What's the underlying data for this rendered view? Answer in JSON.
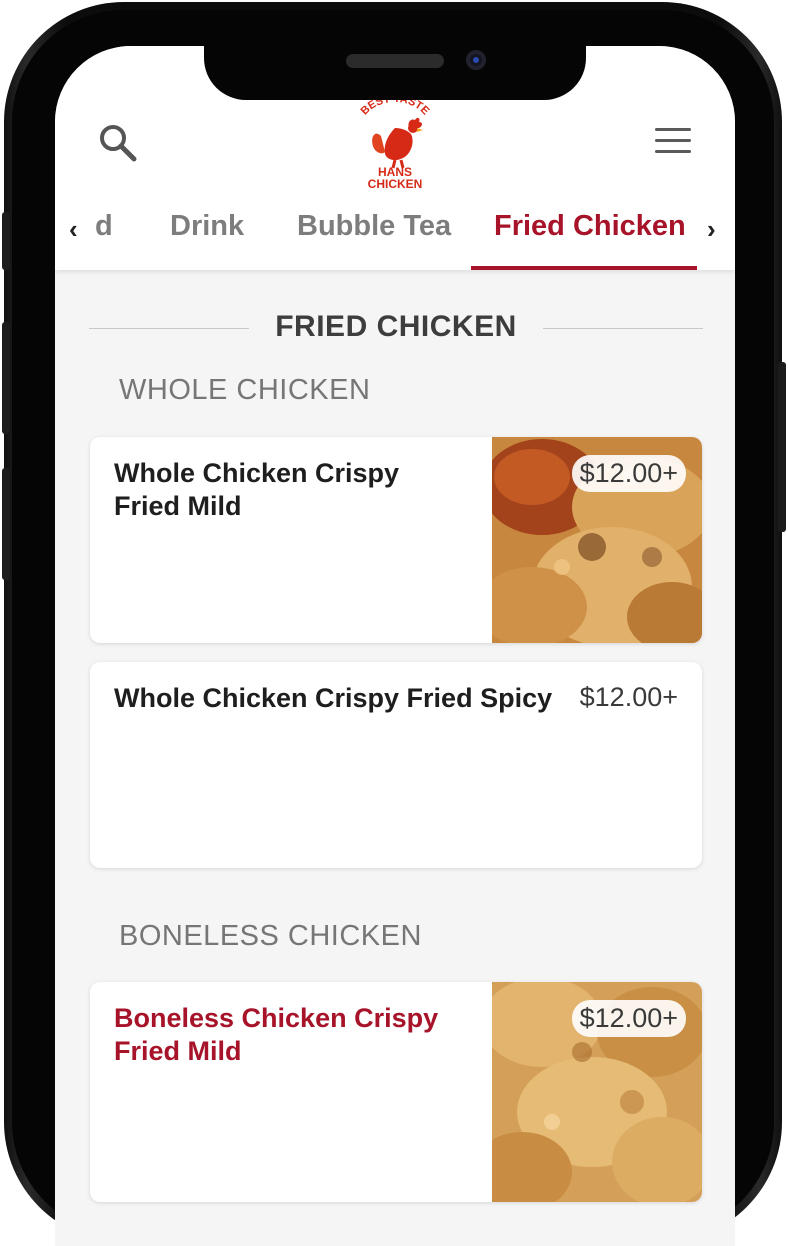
{
  "header": {
    "logo_text": [
      "BEST TASTE",
      "HANS",
      "CHICKEN"
    ]
  },
  "tabs": {
    "left_arrow": "‹",
    "right_arrow": "›",
    "items": [
      {
        "label": "d"
      },
      {
        "label": "Drink"
      },
      {
        "label": "Bubble Tea"
      },
      {
        "label": "Fried Chicken",
        "active": true
      }
    ]
  },
  "section": {
    "title": "FRIED CHICKEN",
    "categories": [
      {
        "title": "WHOLE CHICKEN",
        "items": [
          {
            "name_line1": "Whole Chicken Crispy",
            "name_line2": "Fried Mild",
            "price": "$12.00+",
            "has_image": true
          },
          {
            "name_line1": "Whole Chicken Crispy Fried Spicy",
            "price": "$12.00+",
            "has_image": false
          }
        ]
      },
      {
        "title": "BONELESS CHICKEN",
        "items": [
          {
            "name_line1": "Boneless Chicken Crispy",
            "name_line2": "Fried Mild",
            "price": "$12.00+",
            "has_image": true
          }
        ]
      }
    ]
  },
  "colors": {
    "accent": "#a7142a",
    "tab_inactive": "#7d7d7d",
    "background": "#f5f5f5"
  },
  "icons": [
    "search-icon",
    "hamburger-menu-icon",
    "chevron-left-icon",
    "chevron-right-icon",
    "rooster-logo"
  ]
}
